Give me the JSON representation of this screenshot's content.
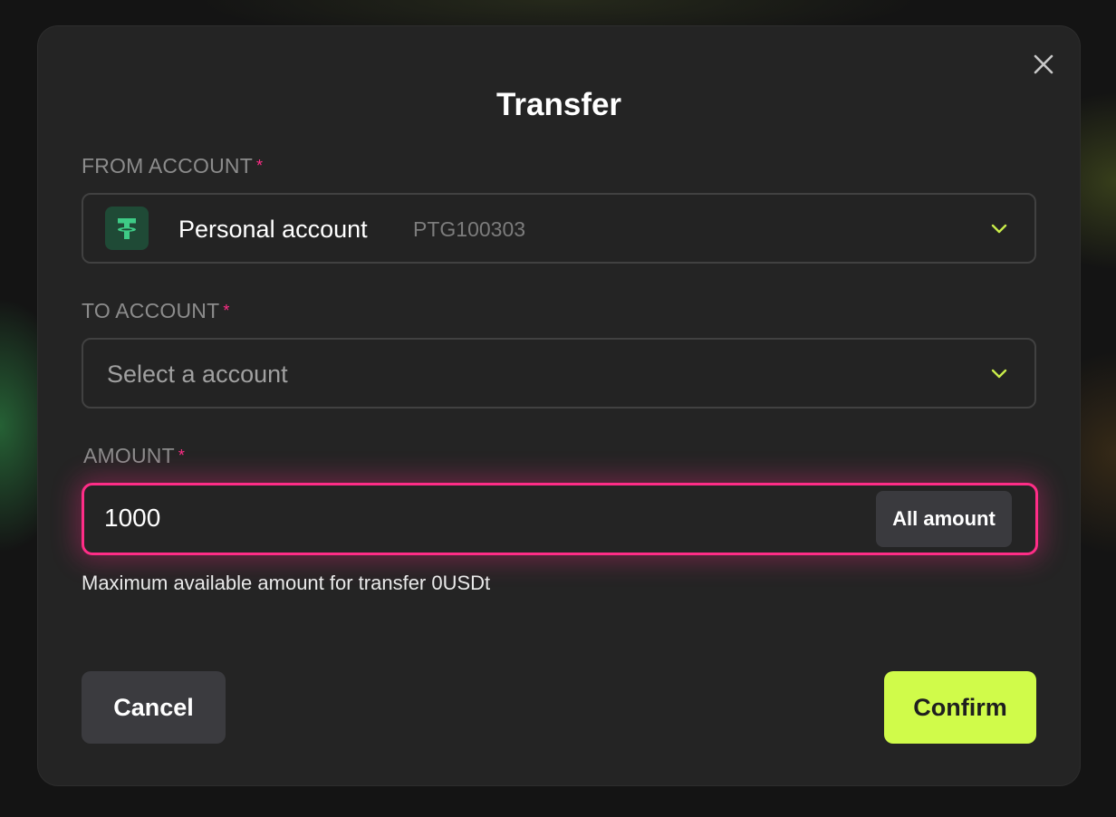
{
  "modal": {
    "title": "Transfer",
    "close_icon": "close-icon"
  },
  "from_account": {
    "label": "FROM ACCOUNT",
    "required_mark": "*",
    "icon": "tether-icon",
    "name": "Personal account",
    "id": "PTG100303"
  },
  "to_account": {
    "label": "TO ACCOUNT",
    "required_mark": "*",
    "placeholder": "Select a account"
  },
  "amount": {
    "label": "AMOUNT",
    "required_mark": "*",
    "value": "1000",
    "all_amount_label": "All amount",
    "hint": "Maximum available amount for transfer 0USDt"
  },
  "actions": {
    "cancel_label": "Cancel",
    "confirm_label": "Confirm"
  },
  "colors": {
    "accent": "#d0fb4a",
    "error": "#ff2d87",
    "token_green": "#3ecb86",
    "modal_bg": "#242424"
  }
}
